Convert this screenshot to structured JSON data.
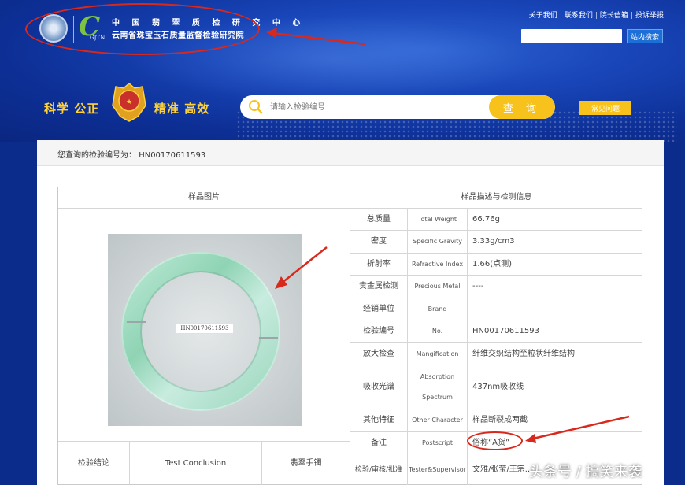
{
  "header": {
    "org_name_line1": "中 国 翡 翠 质 检 研 究 中 心",
    "org_name_line2": "云南省珠宝玉石质量监督检验研究院",
    "logo_sub": "GJTN",
    "top_links": [
      "关于我们",
      "联系我们",
      "院长信箱",
      "投诉举报"
    ],
    "site_search_button": "站内搜索",
    "slogan_left": "科学 公正",
    "slogan_right": "精准 高效",
    "search_placeholder": "请输入检验编号",
    "search_button": "查 询",
    "faq_button": "常见问题"
  },
  "query": {
    "label": "您查询的检验编号为：",
    "number": "HN00170611593"
  },
  "table": {
    "left_header": "样品图片",
    "right_header": "样品描述与检测信息",
    "sample_tag": "HN00170611593",
    "rows": [
      {
        "cn": "总质量",
        "en": "Total Weight",
        "value": "66.76g"
      },
      {
        "cn": "密度",
        "en": "Specific Gravity",
        "value": "3.33g/cm3"
      },
      {
        "cn": "折射率",
        "en": "Refractive Index",
        "value": "1.66(点测)"
      },
      {
        "cn": "贵金属检测",
        "en": "Precious Metal",
        "value": "----"
      },
      {
        "cn": "经销单位",
        "en": "Brand",
        "value": ""
      },
      {
        "cn": "检验编号",
        "en": "No.",
        "value": "HN00170611593"
      },
      {
        "cn": "放大检查",
        "en": "Mangification",
        "value": "纤维交织结构至粒状纤维结构"
      },
      {
        "cn": "吸收光谱",
        "en": "Absorption Spectrum",
        "value": "437nm吸收线"
      },
      {
        "cn": "其他特征",
        "en": "Other Character",
        "value": "样品断裂成两截"
      },
      {
        "cn": "备注",
        "en": "Postscript",
        "value": "俗称“A货”"
      },
      {
        "cn": "检验/审核/批准",
        "en": "Tester&Supervisor",
        "value": "文雅/张莹/王宗..."
      }
    ],
    "conclusion_cn": "检验结论",
    "conclusion_en": "Test Conclusion",
    "conclusion_value": "翡翠手镯"
  },
  "watermark": "头条号 / 搞笑来袭",
  "colors": {
    "header_blue": "#1845b8",
    "accent_yellow": "#f6c21b",
    "annotation_red": "#d9281c",
    "jade_green": "#8fd3b4"
  }
}
